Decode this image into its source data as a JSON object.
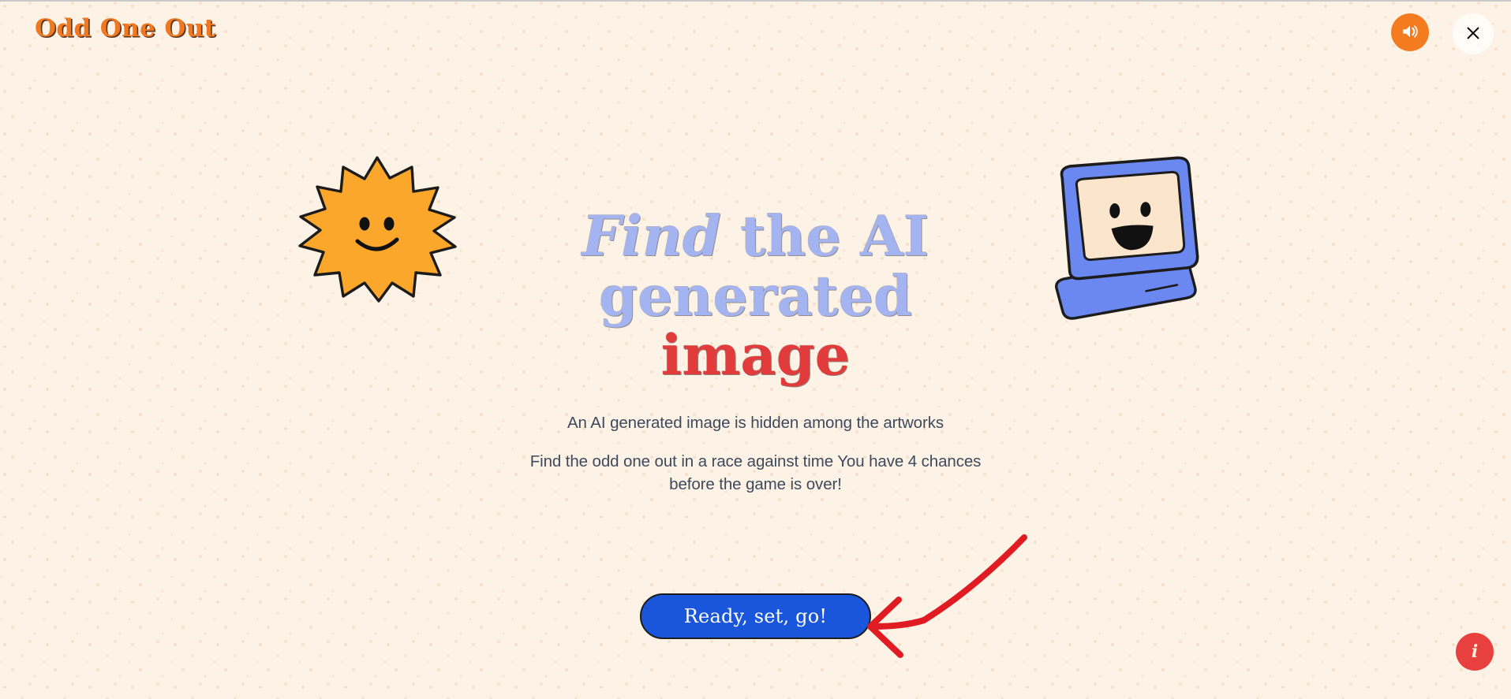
{
  "app": {
    "title": "Odd One Out",
    "background_color": "#FDF2E6",
    "accent_orange": "#F07820",
    "accent_blue": "#A3B4F0",
    "accent_red": "#E23B3B",
    "button_blue": "#1A56DB",
    "text_color": "#3E4A5C"
  },
  "header": {
    "title": "Odd One Out",
    "sound_icon": "speaker-on-icon",
    "sound_label": "Sound",
    "close_icon": "close-icon",
    "close_label": "Close"
  },
  "hero": {
    "headline_part_1": "Find",
    "headline_part_2": " the AI",
    "headline_part_3": "generated ",
    "headline_part_4": "image",
    "subtitle_primary": "An AI generated image is hidden among the artworks",
    "subtitle_secondary": "Find the odd one out in a race against time You have 4 chances before the game is over!",
    "chances": "4"
  },
  "illustrations": {
    "left": "smiling-sun-icon",
    "right": "smiling-retro-computer-icon",
    "arrow": "hand-drawn-red-arrow-icon",
    "sun_fill": "#FBA72B",
    "computer_fill": "#6B87F0",
    "computer_screen_fill": "#FBE5CC",
    "arrow_color": "#E01B22"
  },
  "actions": {
    "start_label": "Ready, set, go!",
    "info_glyph": "i",
    "info_label": "Info"
  }
}
